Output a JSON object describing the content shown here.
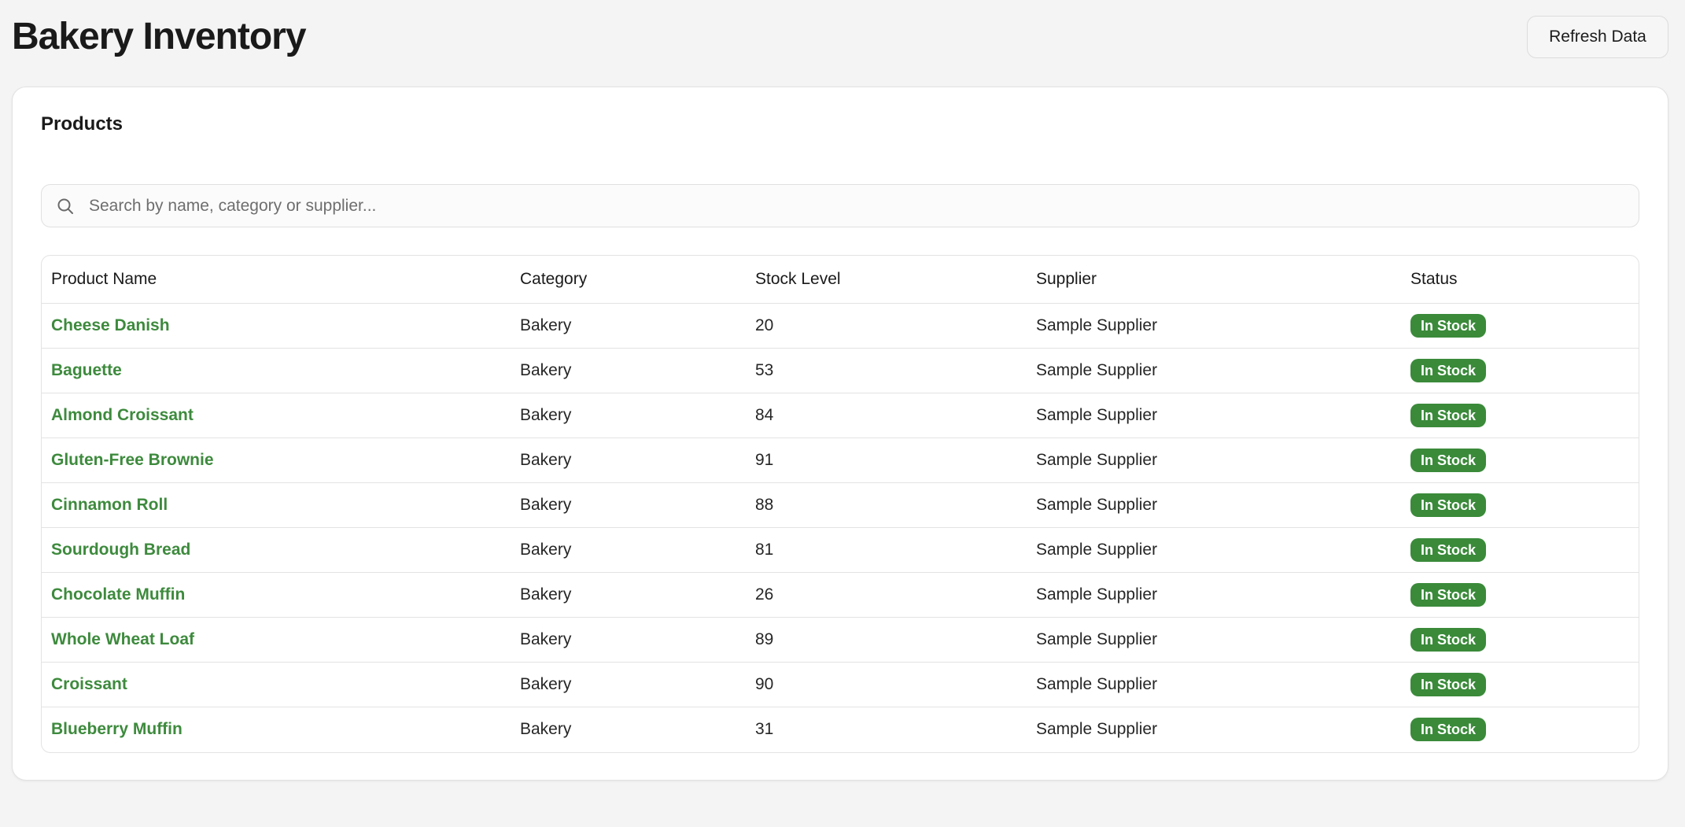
{
  "header": {
    "title": "Bakery Inventory",
    "refresh_label": "Refresh Data"
  },
  "card": {
    "title": "Products"
  },
  "search": {
    "placeholder": "Search by name, category or supplier...",
    "value": "",
    "icon": "search-icon"
  },
  "table": {
    "columns": [
      "Product Name",
      "Category",
      "Stock Level",
      "Supplier",
      "Status"
    ],
    "rows": [
      {
        "name": "Cheese Danish",
        "category": "Bakery",
        "stock": "20",
        "supplier": "Sample Supplier",
        "status": "In Stock"
      },
      {
        "name": "Baguette",
        "category": "Bakery",
        "stock": "53",
        "supplier": "Sample Supplier",
        "status": "In Stock"
      },
      {
        "name": "Almond Croissant",
        "category": "Bakery",
        "stock": "84",
        "supplier": "Sample Supplier",
        "status": "In Stock"
      },
      {
        "name": "Gluten-Free Brownie",
        "category": "Bakery",
        "stock": "91",
        "supplier": "Sample Supplier",
        "status": "In Stock"
      },
      {
        "name": "Cinnamon Roll",
        "category": "Bakery",
        "stock": "88",
        "supplier": "Sample Supplier",
        "status": "In Stock"
      },
      {
        "name": "Sourdough Bread",
        "category": "Bakery",
        "stock": "81",
        "supplier": "Sample Supplier",
        "status": "In Stock"
      },
      {
        "name": "Chocolate Muffin",
        "category": "Bakery",
        "stock": "26",
        "supplier": "Sample Supplier",
        "status": "In Stock"
      },
      {
        "name": "Whole Wheat Loaf",
        "category": "Bakery",
        "stock": "89",
        "supplier": "Sample Supplier",
        "status": "In Stock"
      },
      {
        "name": "Croissant",
        "category": "Bakery",
        "stock": "90",
        "supplier": "Sample Supplier",
        "status": "In Stock"
      },
      {
        "name": "Blueberry Muffin",
        "category": "Bakery",
        "stock": "31",
        "supplier": "Sample Supplier",
        "status": "In Stock"
      }
    ]
  },
  "colors": {
    "page_background": "#f4f4f4",
    "product_link": "#3d8a3d",
    "status_in_stock": "#3a8a3a"
  }
}
